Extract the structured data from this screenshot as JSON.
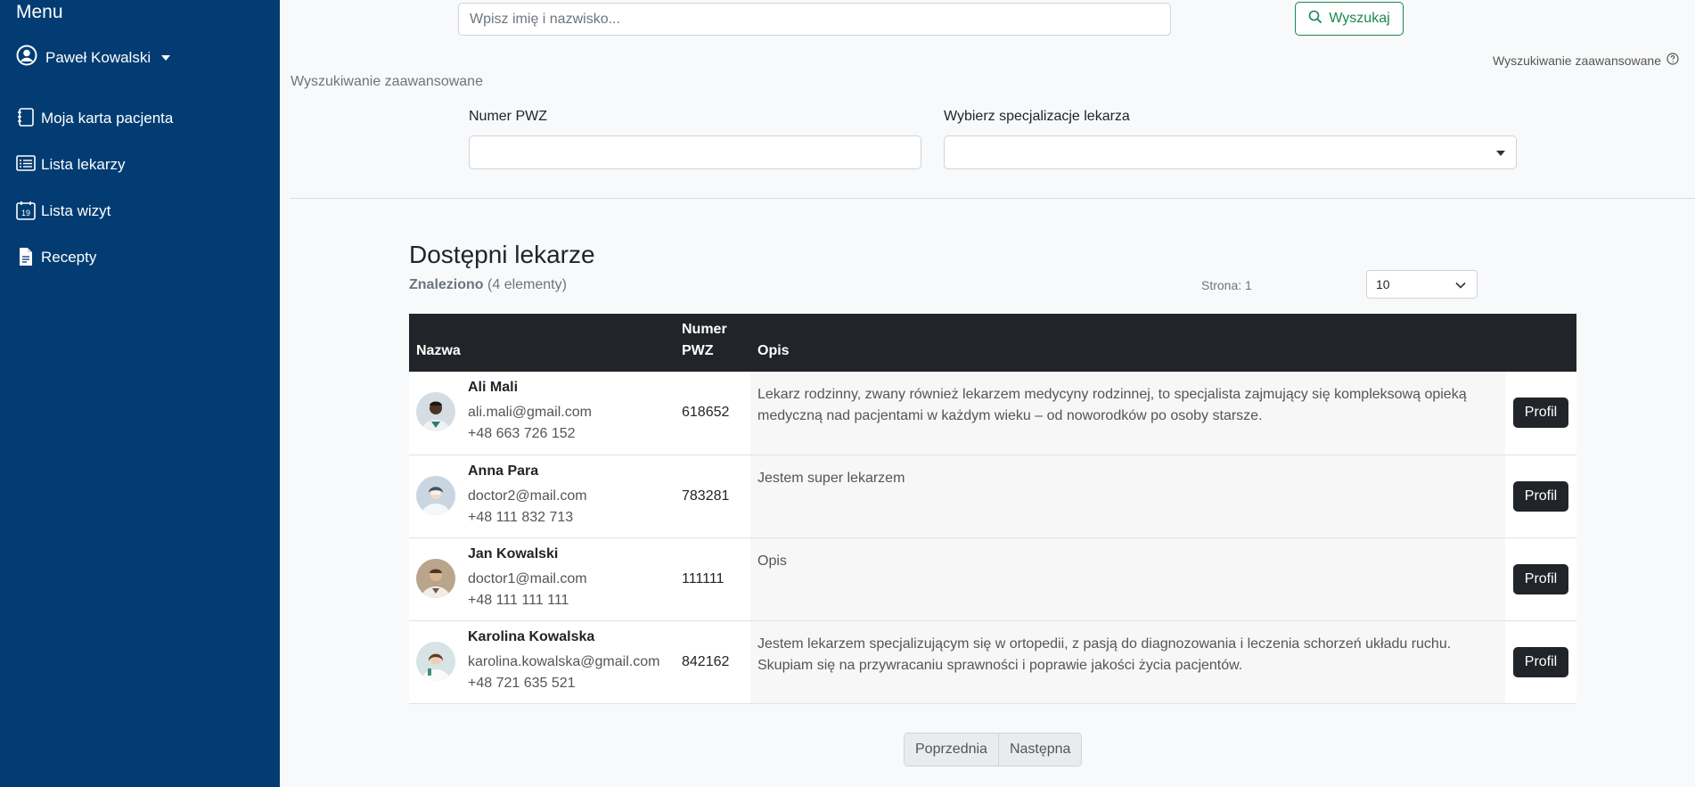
{
  "sidebar": {
    "menu_title": "Menu",
    "user_name": "Paweł Kowalski",
    "items": [
      {
        "label": "Moja karta pacjenta",
        "icon": "notebook-icon"
      },
      {
        "label": "Lista lekarzy",
        "icon": "list-icon"
      },
      {
        "label": "Lista wizyt",
        "icon": "calendar-icon",
        "calendar_day": "19"
      },
      {
        "label": "Recepty",
        "icon": "document-icon"
      }
    ]
  },
  "search": {
    "placeholder": "Wpisz imię i nazwisko...",
    "button_label": "Wyszukaj",
    "advanced_link": "Wyszukiwanie zaawansowane"
  },
  "advanced": {
    "title": "Wyszukiwanie zaawansowane",
    "pwz_label": "Numer PWZ",
    "pwz_value": "",
    "spec_label": "Wybierz specjalizacje lekarza",
    "spec_value": ""
  },
  "list": {
    "title": "Dostępni lekarze",
    "found_label": "Znaleziono",
    "found_count": "(4 elementy)",
    "page_info": "Strona: 1",
    "page_size": "10"
  },
  "table": {
    "headers": {
      "name": "Nazwa",
      "pwz_line1": "Numer",
      "pwz_line2": "PWZ",
      "desc": "Opis"
    },
    "rows": [
      {
        "name": "Ali Mali",
        "email": "ali.mali@gmail.com",
        "phone": "+48 663 726 152",
        "pwz": "618652",
        "desc": "Lekarz rodzinny, zwany również lekarzem medycyny rodzinnej, to specjalista zajmujący się kompleksową opieką medyczną nad pacjentami w każdym wieku – od noworodków po osoby starsze.",
        "action": "Profil"
      },
      {
        "name": "Anna Para",
        "email": "doctor2@mail.com",
        "phone": "+48 111 832 713",
        "pwz": "783281",
        "desc": "Jestem super lekarzem",
        "action": "Profil"
      },
      {
        "name": "Jan Kowalski",
        "email": "doctor1@mail.com",
        "phone": "+48 111 111 111",
        "pwz": "111111",
        "desc": "Opis",
        "action": "Profil"
      },
      {
        "name": "Karolina Kowalska",
        "email": "karolina.kowalska@gmail.com",
        "phone": "+48 721 635 521",
        "pwz": "842162",
        "desc": "Jestem lekarzem specjalizującym się w ortopedii, z pasją do diagnozowania i leczenia schorzeń układu ruchu. Skupiam się na przywracaniu sprawności i poprawie jakości życia pacjentów.",
        "action": "Profil"
      }
    ]
  },
  "pagination": {
    "prev": "Poprzednia",
    "next": "Następna"
  },
  "colors": {
    "sidebar": "#023c72",
    "accent": "#198754",
    "dark": "#212529"
  }
}
